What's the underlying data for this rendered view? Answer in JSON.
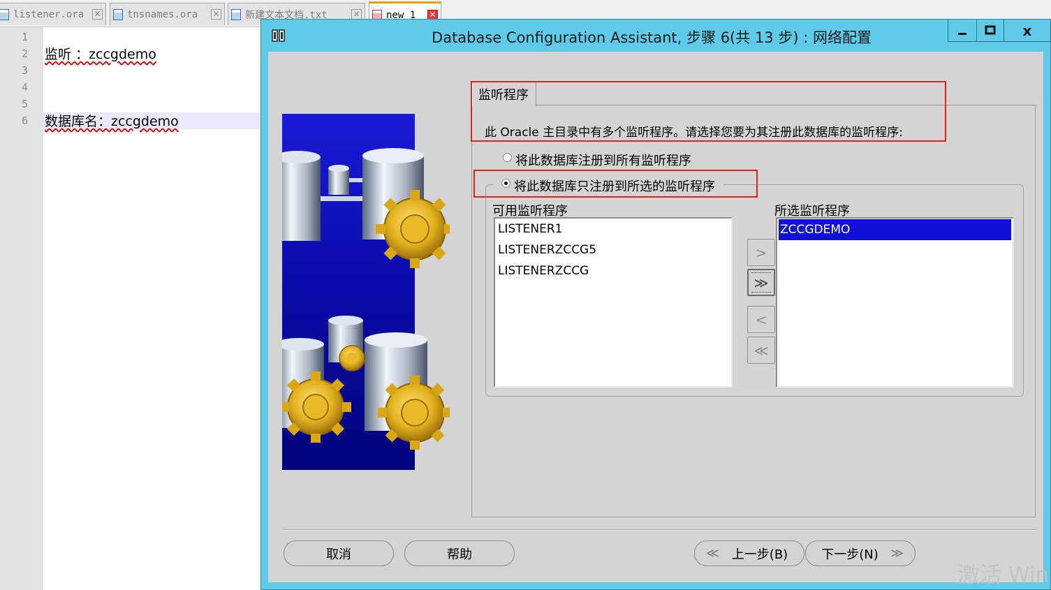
{
  "notepad": {
    "tabs": [
      {
        "label": "listener.ora"
      },
      {
        "label": "tnsnames.ora"
      },
      {
        "label": "新建文本文档.txt"
      },
      {
        "label": "new 1"
      }
    ],
    "line_numbers": [
      "1",
      "2",
      "3",
      "4",
      "5",
      "6"
    ],
    "lines": {
      "line2": "监听 ：zccgdemo",
      "line6": "数据库名：zccgdemo"
    }
  },
  "dialog": {
    "title": "Database Configuration Assistant, 步骤 6(共 13 步) : 网络配置",
    "close_label": "x",
    "tab_label": "监听程序",
    "description": "此 Oracle 主目录中有多个监听程序。请选择您要为其注册此数据库的监听程序:",
    "radio_all": {
      "label": "将此数据库注册到所有监听程序",
      "checked": false
    },
    "radio_selected": {
      "label": "将此数据库只注册到所选的监听程序",
      "checked": true
    },
    "available": {
      "label": "可用监听程序",
      "items": [
        "LISTENER1",
        "LISTENERZCCG5",
        "LISTENERZCCG"
      ]
    },
    "selected": {
      "label": "所选监听程序",
      "items": [
        "ZCCGDEMO"
      ]
    },
    "move_buttons": {
      "add_one": ">",
      "add_all": "≫",
      "remove_one": "<",
      "remove_all": "≪"
    },
    "buttons": {
      "cancel": "取消",
      "help": "帮助",
      "back": "上一步(B)",
      "next": "下一步(N)",
      "back_chevron": "≪",
      "next_chevron": "≫"
    }
  },
  "watermark": "激活 Win",
  "colors": {
    "title_bar": "#5ecbe8",
    "dialog_bg": "#d4d4d4",
    "selection": "#1010d8",
    "annotation_red": "#e02020"
  }
}
